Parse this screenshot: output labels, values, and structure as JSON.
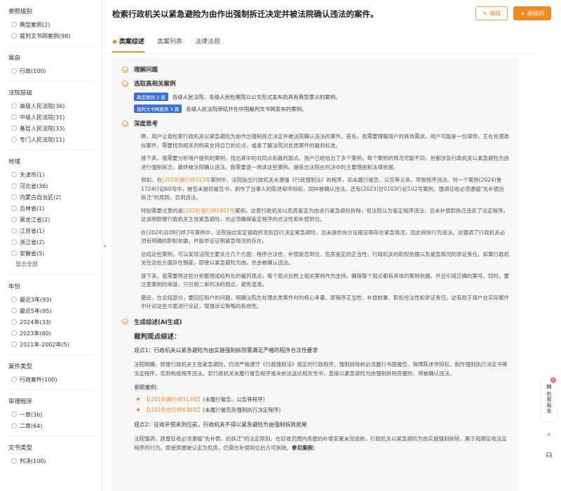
{
  "sidebar": {
    "groups": [
      {
        "title": "参照级别",
        "items": [
          "典型案例(2)",
          "裁判文书网案例(98)"
        ]
      },
      {
        "title": "案由",
        "items": [
          "行政(100)"
        ]
      },
      {
        "title": "法院层级",
        "items": [
          "高级人民法院(36)",
          "中级人民法院(31)",
          "基层人民法院(33)",
          "专门人民法院(11)"
        ]
      },
      {
        "title": "地域",
        "items": [
          "天津市(1)",
          "河北省(36)",
          "内蒙古自治区(2)",
          "吉林省(1)",
          "黑龙江省(2)",
          "江苏省(1)",
          "浙江省(2)",
          "安徽省(5)"
        ],
        "show_all": "显示全部"
      },
      {
        "title": "年份",
        "items": [
          "最近3年(93)",
          "最近5年(95)",
          "2024年(33)",
          "2023年(60)",
          "2021年-2002年(5)"
        ]
      },
      {
        "title": "案件类型",
        "items": [
          "行政案件(100)"
        ]
      },
      {
        "title": "审理程序",
        "items": [
          "一审(36)",
          "二审(64)"
        ]
      },
      {
        "title": "文书类型",
        "items": [
          "判决(100)"
        ]
      }
    ]
  },
  "header": {
    "title": "检索行政机关以紧急避险为由作出强制拆迁决定并被法院确认违法的案件。",
    "edit_label": "编辑",
    "ask_label": "继续问"
  },
  "tabs": [
    "类案综述",
    "类案列表",
    "法律法规"
  ],
  "content": {
    "steps": [
      "理解问题",
      "选取高相关案例",
      "深度思考",
      "生成综述(AI生成)"
    ],
    "badges": [
      {
        "badge": "典型案例 2 篇",
        "text": "各级人民法院、各级人民检察院以公文形式发布的具有典型意义的案例。"
      },
      {
        "badge": "裁判文书网案例 3 篇",
        "text": "各级人民法院审结并在中国裁判文书网发布的案例。"
      }
    ],
    "think": [
      {
        "pre": "嗯，用户让我检索行政机关以紧急避险为由作出强制拆迁决定并被法院确认违法的案件。首先，我需要理解用户的具体需求。用户可能是一位律师，正在处理类似案件，需要找到相关判例来支持自己的论点，或者了解法院对此类案件的裁判标准。"
      },
      {
        "pre": "接下来，我需要分析用户提供的案例，找出其中的共同点和裁判观点。用户已经给出了多个案例，每个案例的情况可能不同，但都涉及行政机关以紧急避险为由进行强制拆迁，最终被法院确认违法。我需要逐一阅读这些案例，提炼出法院在判决中的主要理由和法律依据。"
      },
      {
        "pre": "例如，在",
        "link": "(2018)冀行终313号",
        "post": "案例中，法院指出行政机关未遵循《行政强制法》的程序，如未履行催告、公告等义务，导致程序违法。另一个案例(2024)鲁1724行初60号中，被告未提供催告书，剥夺了当事人的陈述和申辩权，同样被确认违法。还有(2023)甘0103行初102号案例，强调征收必须遵循\"先补偿后拆迁\"的原则，否则违法。"
      },
      {
        "pre": "特别需要注意的是",
        "link": "(2018)湘行终1991号",
        "post": "案例，这里行政机关以危房鉴定为由进行紧急避险拆除，但法院认为鉴定程序违法，且未补偿即拆迁违反了法定程序。这说明即便行政机关主张紧急避险，也必须确保鉴定程序的合法性和补偿到位。"
      },
      {
        "pre": "在(2024)云08行终3号案例中，法院指出安定镇政府无权自行决定紧急避险，且未提供充分证据证明存在紧急情况，因此拆除行为违法。这强调了行政机关必须有明确的职权依据，并能举证证明紧急情况的存在。"
      },
      {
        "pre": "总结这些案例，可以发现法院主要关注几个方面：程序合法性、补偿是否到位、危房鉴定的正当性、行政机关的职权依据以及紧急情况的举证责任。如果行政机关在这些方面存在瑕疵，即使以紧急避险为由，也会被确认违法。"
      },
      {
        "pre": "接下来，我需要将这些分析整理成结构化的裁判观点，每个观点后附上相关案例作为支持。确保每个观点都有具体的案例依据，并且引用正确的案号。同时，要注意案例的审级，只引用二审判决的观点，避免混淆。"
      },
      {
        "pre": "最后，在总结部分，要回应用户的问题，明确法院在处理此类案件时的核心考量，即程序正当性、补偿前置、职权合法性和举证责任。这有助于用户在实际案件中针对这些方面进行论证，增强诉讼策略的有效性。"
      }
    ],
    "summary_head": "裁判观点综述：",
    "point1": "观点1：行政机关以紧急避险为由实施强制拆除需满足严格的程序合法性要求",
    "point1_para": "法院明确，即便行政机关主张紧急避险，仍须严格遵守《行政强制法》规定的行政程序。强制拆除前必须履行书面催告、保障陈述申辩权、制作强制执行决定书等法定程序，否则构成程序违法。若行政机关未履行催告程序或未依法送达相关文书，直接以紧急避险为由强制拆除房屋的，将被确认违法。",
    "ref_title": "参照案例：",
    "refs": [
      {
        "link": "【(2018)冀行终313号】",
        "text": "(未履行催告、公告等程序)"
      },
      {
        "link": "【(2018)甘行终638号】",
        "text": "(未履行催告及强制执行决定程序)"
      }
    ],
    "point2": "观点2：征收补偿未到位前，行政机关不得以紧急避险为由强制拆除房屋",
    "point2_para": "法院强调，房屋征收必须遵循\"先补偿、后拆迁\"的法定原则。在征收范围内房屋的补偿安置未完成前，行政机关以紧急避险为由实施强制拆除，属于规避征收法定程序的行为。即使房屋被认定为危房，仍需在补偿到位后方可拆除。",
    "point2_tail": "参见案例："
  },
  "right_bar": {
    "badge": "1",
    "report_label": "检索报告"
  }
}
